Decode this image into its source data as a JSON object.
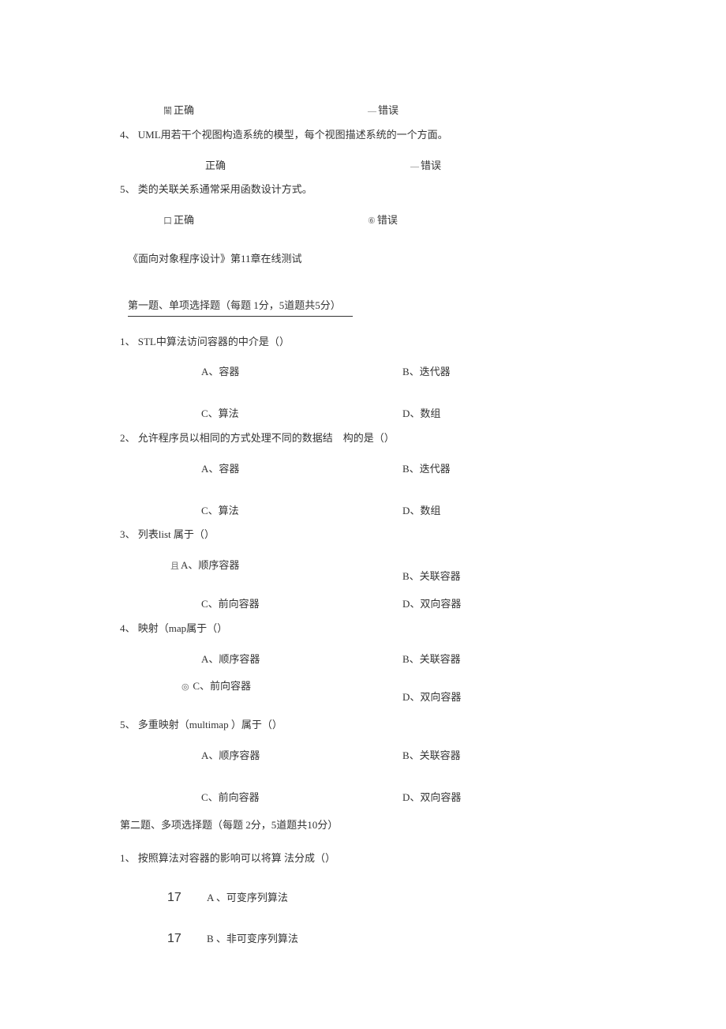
{
  "tf": {
    "correct": "正确",
    "wrong": "错误",
    "prefix_mark1": "闈",
    "prefix_dash": "—",
    "prefix_box": "口",
    "prefix_circ6": "⑥"
  },
  "q4_prev": "4、 UML用若干个视图构造系统的模型，每个视图描述系统的一个方面。",
  "q5_prev": "5、 类的关联关系通常采用函数设计方式。",
  "chapter_title_a": "《面向对象程序设计》第",
  "chapter_title_b": "11章在线测试",
  "section1_title": "第一题、单项选择题（每题 1分，5道题共5分）",
  "s1q1": "1、 STL中算法访问容器的中介是（）",
  "s1q2": "2、 允许程序员以相同的方式处理不同的数据结 构的是（）",
  "s1q3": "3、 列表list 属于（）",
  "s1q4": "4、 映射（map属于（）",
  "s1q5": "5、 多重映射（multimap ）属于（）",
  "container_optA": "A、容器",
  "container_optB": "B、迭代器",
  "container_optC": "C、算法",
  "container_optD": "D、数组",
  "ctype_optA": "A、顺序容器",
  "ctype_optB": "B、关联容器",
  "ctype_optC": "C、前向容器",
  "ctype_optD": "D、双向容器",
  "q3_mark_prefix": "且",
  "q4_mark_prefix": "◎ ",
  "section2_title": "第二题、多项选择题（每题 2分，5道题共10分）",
  "s2q1": "1、 按照算法对容器的影响可以将算 法分成（）",
  "multi_num": "17",
  "s2q1_optA": "A 、可变序列算法",
  "s2q1_optB": "B 、非可变序列算法"
}
